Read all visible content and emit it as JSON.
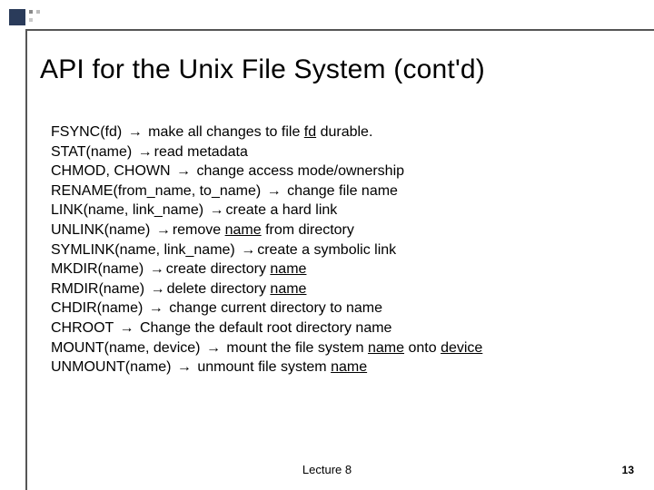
{
  "title": "API for the Unix File System (cont'd)",
  "arrow": "→",
  "lines": {
    "l1": {
      "call": "FSYNC(fd)",
      "desc_pre": " make all changes to file ",
      "u1": "fd",
      "desc_post": " durable."
    },
    "l2": {
      "call": "STAT(name)",
      "desc": "read metadata"
    },
    "l3": {
      "call": "CHMOD, CHOWN",
      "desc": " change access mode/ownership"
    },
    "l4": {
      "call": "RENAME(from_name, to_name)",
      "desc": " change file name"
    },
    "l5": {
      "call": "LINK(name, link_name)",
      "desc": "create a hard link"
    },
    "l6": {
      "call": "UNLINK(name)",
      "desc_pre": "remove ",
      "u1": "name",
      "desc_post": " from directory"
    },
    "l7": {
      "call": "SYMLINK(name, link_name)",
      "desc": "create a symbolic link"
    },
    "l8": {
      "call": "MKDIR(name)",
      "desc_pre": "create directory ",
      "u1": "name"
    },
    "l9": {
      "call": "RMDIR(name)",
      "desc_pre": "delete directory ",
      "u1": "name"
    },
    "l10": {
      "call": "CHDIR(name)",
      "desc": " change current directory to name"
    },
    "l11": {
      "call": "CHROOT",
      "desc": " Change the default root directory name"
    },
    "l12": {
      "call": "MOUNT(name, device)",
      "desc_pre": " mount the file system ",
      "u1": "name",
      "desc_mid": " onto ",
      "u2": "device"
    },
    "l13": {
      "call": "UNMOUNT(name)",
      "desc_pre": " unmount file system ",
      "u1": "name"
    }
  },
  "footer": {
    "center": "Lecture 8",
    "page": "13"
  }
}
